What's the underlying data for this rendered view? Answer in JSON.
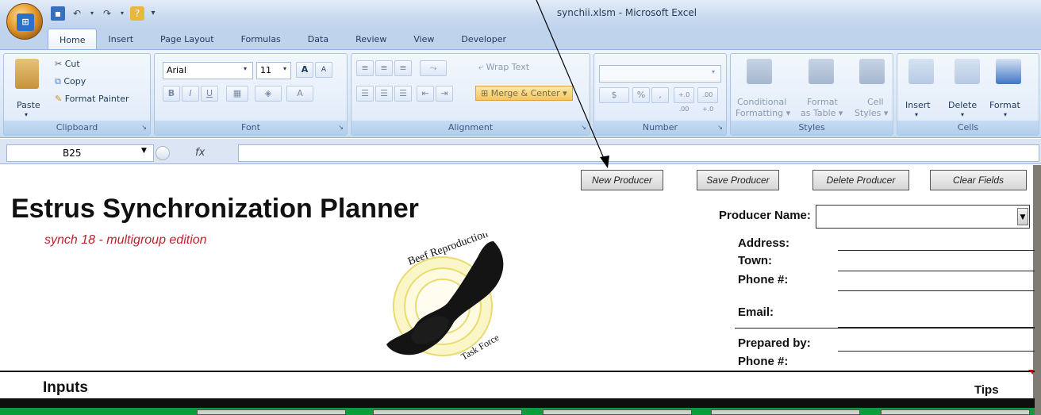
{
  "window": {
    "title": "synchii.xlsm - Microsoft Excel"
  },
  "tabs": [
    "Home",
    "Insert",
    "Page Layout",
    "Formulas",
    "Data",
    "Review",
    "View",
    "Developer"
  ],
  "active_tab": "Home",
  "ribbon": {
    "clipboard": {
      "label": "Clipboard",
      "paste": "Paste",
      "cut": "Cut",
      "copy": "Copy",
      "format_painter": "Format Painter"
    },
    "font": {
      "label": "Font",
      "font_name": "Arial",
      "font_size": "11",
      "bold": "B",
      "italic": "I",
      "underline": "U",
      "grow": "A",
      "shrink": "A",
      "color": "A"
    },
    "alignment": {
      "label": "Alignment",
      "wrap_text": "Wrap Text",
      "merge_center": "Merge & Center"
    },
    "number": {
      "label": "Number",
      "currency": "$",
      "percent": "%",
      "comma": ",",
      "inc_dec": "+.0 .00",
      "dec_dec": ".00 +.0"
    },
    "styles": {
      "label": "Styles",
      "conditional": "Conditional",
      "conditional2": "Formatting",
      "format_as": "Format",
      "format_as2": "as Table",
      "cell": "Cell",
      "cell2": "Styles"
    },
    "cells": {
      "label": "Cells",
      "insert": "Insert",
      "delete": "Delete",
      "format": "Format"
    }
  },
  "formula_bar": {
    "name_box": "B25",
    "fx": "fx",
    "value": ""
  },
  "sheet": {
    "buttons": {
      "new_producer": "New Producer",
      "save_producer": "Save Producer",
      "delete_producer": "Delete Producer",
      "clear_fields": "Clear Fields"
    },
    "title": "Estrus Synchronization Planner",
    "subtitle": "synch 18 - multigroup edition",
    "logo_text": {
      "top": "Beef Reproduction",
      "bottom": "Task Force"
    },
    "fields": {
      "producer_name": "Producer Name:",
      "address": "Address:",
      "town": "Town:",
      "phone": "Phone #:",
      "email": "Email:",
      "prepared_by": "Prepared by:",
      "phone2": "Phone #:"
    },
    "producer_name_value": "",
    "inputs_label": "Inputs",
    "tips_label": "Tips"
  }
}
